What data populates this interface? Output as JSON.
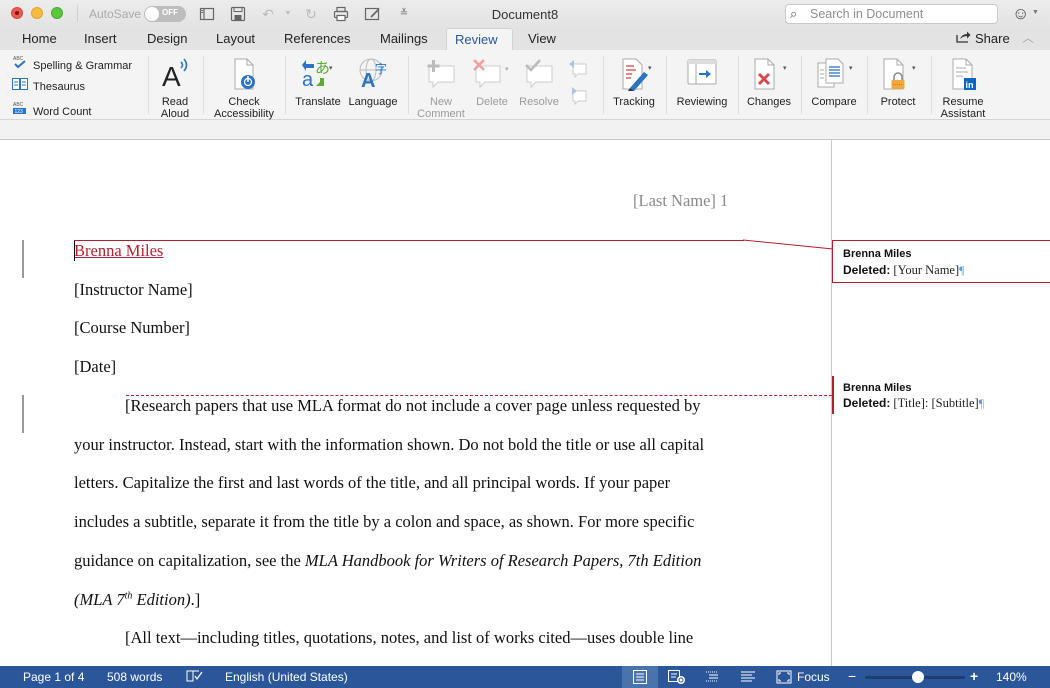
{
  "window": {
    "title": "Document8",
    "autosave_label": "AutoSave",
    "autosave_state": "OFF",
    "search_placeholder": "Search in Document"
  },
  "tabs": [
    {
      "label": "Home"
    },
    {
      "label": "Insert"
    },
    {
      "label": "Design"
    },
    {
      "label": "Layout"
    },
    {
      "label": "References"
    },
    {
      "label": "Mailings"
    },
    {
      "label": "Review",
      "active": true
    },
    {
      "label": "View"
    }
  ],
  "share_label": "Share",
  "ribbon": {
    "proofing": [
      {
        "label": "Spelling & Grammar",
        "icon": "spelling-check-icon"
      },
      {
        "label": "Thesaurus",
        "icon": "thesaurus-book-icon"
      },
      {
        "label": "Word Count",
        "icon": "word-count-icon"
      }
    ],
    "read_aloud": {
      "line1": "Read",
      "line2": "Aloud"
    },
    "check_accessibility": {
      "line1": "Check",
      "line2": "Accessibility"
    },
    "translate": "Translate",
    "language": "Language",
    "new_comment": {
      "line1": "New",
      "line2": "Comment"
    },
    "delete": "Delete",
    "resolve": "Resolve",
    "tracking": "Tracking",
    "reviewing": "Reviewing",
    "changes": "Changes",
    "compare": "Compare",
    "protect": "Protect",
    "resume_assistant": {
      "line1": "Resume",
      "line2": "Assistant"
    }
  },
  "document": {
    "header": "[Last Name] 1",
    "inserted_name": "Brenna Miles",
    "instructor": "[Instructor Name]",
    "course": "[Course Number]",
    "date": "[Date]",
    "para1_lines": [
      "[Research papers that use MLA format do not include a cover page unless requested by",
      "your instructor. Instead, start with the information shown. Do not bold the title or use all capital",
      "letters. Capitalize the first and last words of the title, and all principal words. If your paper",
      "includes a subtitle, separate it from the title by a colon and space, as shown. For more specific"
    ],
    "para1_line5_plain": "guidance on capitalization, see the ",
    "para1_line5_italic": "MLA Handbook for Writers of Research Papers, 7th Edition",
    "para1_line6_italic_a": "(MLA 7",
    "para1_line6_sup": "th",
    "para1_line6_italic_b": " Edition)",
    "para1_line6_end": ".]",
    "para2_line1": "[All text—including titles, quotations, notes, and list of works cited—uses double line"
  },
  "comments": [
    {
      "author": "Brenna Miles",
      "action": "Deleted:",
      "text": "[Your Name]",
      "mark": "¶"
    },
    {
      "author": "Brenna Miles",
      "action": "Deleted:",
      "text": "[Title]: [Subtitle]",
      "mark": "¶"
    }
  ],
  "status": {
    "page": "Page 1 of 4",
    "words": "508 words",
    "language": "English (United States)",
    "focus": "Focus",
    "zoom": "140%",
    "zoom_percent": 140
  },
  "colors": {
    "accent": "#2b579a",
    "track_change": "#b21e2f",
    "pilcrow": "#5b9bd5"
  }
}
